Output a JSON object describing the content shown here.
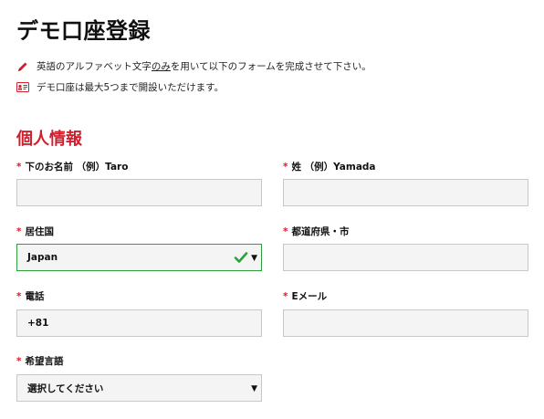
{
  "page": {
    "title": "デモ口座登録",
    "notes": [
      {
        "icon": "pencil-icon",
        "text_before": "英語のアルファベット文字",
        "text_underline": "のみ",
        "text_after": "を用いて以下のフォームを完成させて下さい。"
      },
      {
        "icon": "id-card-icon",
        "text": "デモ口座は最大5つまで開設いただけます。"
      }
    ],
    "section_title": "個人情報"
  },
  "form": {
    "required_mark": "*",
    "first_name": {
      "label": "下のお名前 （例）Taro",
      "value": ""
    },
    "last_name": {
      "label": "姓 （例）Yamada",
      "value": ""
    },
    "country": {
      "label": "居住国",
      "value": "Japan",
      "status": "valid"
    },
    "city": {
      "label": "都道府県・市",
      "value": ""
    },
    "phone": {
      "label": "電話",
      "value": "+81"
    },
    "email": {
      "label": "Eメール",
      "value": ""
    },
    "language": {
      "label": "希望言語",
      "value": "選択してください"
    }
  },
  "colors": {
    "accent": "#d0202e",
    "valid": "#2e9e3e",
    "field_bg": "#f4f4f4"
  }
}
